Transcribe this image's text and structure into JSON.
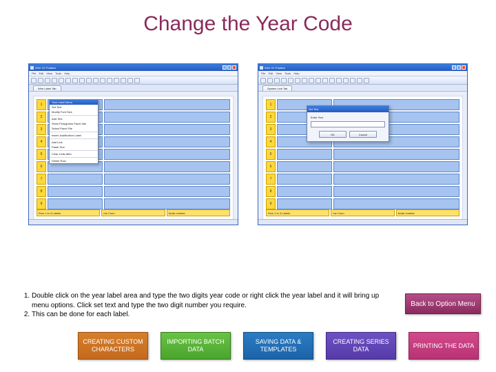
{
  "title": "Change the Year Code",
  "screenshots": {
    "window_title": "Wire G2 Position",
    "menubar": [
      "File",
      "Edit",
      "View",
      "Tools",
      "Help"
    ],
    "doc_tab": "Wire Label Tab",
    "rows": [
      "1",
      "2",
      "3",
      "4",
      "5",
      "6",
      "7",
      "8",
      "9"
    ],
    "footer_cells": [
      "Row 1 to 3 Labels",
      "me Conn",
      "Node number"
    ],
    "context_menu": {
      "header": "Year Label Menu",
      "items": [
        "Set Text",
        "Modify Font Size",
        "",
        "Add Text",
        "Show Pictograms Panel Info",
        "Select Panel File",
        "",
        "Insert Justification Label",
        "",
        "Add Link",
        "Paste Text",
        "",
        "Clear Cells After",
        "",
        "Delete Row"
      ]
    },
    "dialog": {
      "title": "Set Text",
      "label": "Enter Text",
      "input_value": "",
      "ok": "OK",
      "cancel": "Cancel"
    },
    "window_title_right": "Wire G1 Position",
    "doc_tab_right": "System Link Tab",
    "footer_cells_right": [
      "Row 1 to 3 Labels",
      "me Conn",
      "Node number"
    ]
  },
  "instructions": {
    "item1": "Double click on the year label area and type the two digits year code or right click the year label and it will bring up menu options. Click set text and type the two digit number you require.",
    "item2": "This can be done for each label."
  },
  "back_button": "Back to Option Menu",
  "nav": {
    "n1": "CREATING CUSTOM CHARACTERS",
    "n2": "IMPORTING BATCH DATA",
    "n3": "SAVING DATA & TEMPLATES",
    "n4": "CREATING SERIES DATA",
    "n5": "PRINTING THE DATA"
  }
}
